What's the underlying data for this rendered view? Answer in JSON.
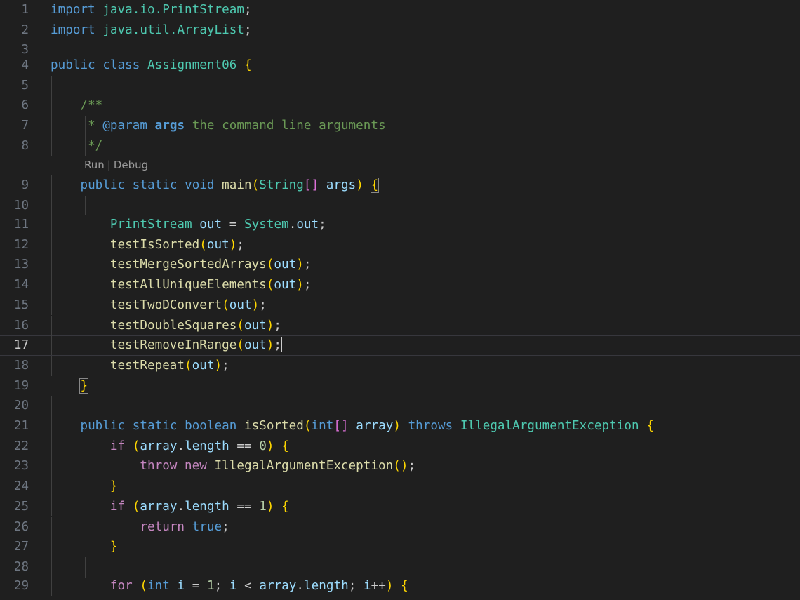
{
  "editor": {
    "language": "java",
    "theme": "Dark Modern",
    "background_color": "#1f1f1f",
    "active_line_number": 17,
    "cursor_line": 17,
    "cursor_column": 31,
    "gutter": {
      "line_numbers": [
        1,
        2,
        3,
        4,
        5,
        6,
        7,
        8,
        9,
        10,
        11,
        12,
        13,
        14,
        15,
        16,
        17,
        18,
        19,
        20,
        21,
        22,
        23,
        24,
        25,
        26,
        27,
        28,
        29
      ],
      "inactive_color": "#6e7681",
      "active_color": "#cccccc"
    },
    "codelens": {
      "run_label": "Run",
      "separator": "|",
      "debug_label": "Debug",
      "attached_to_line": 9
    },
    "syntax_colors": {
      "keyword": "#569cd6",
      "control_keyword": "#c586c0",
      "type": "#4ec9b0",
      "function": "#dcdcaa",
      "variable": "#9cdcfe",
      "number": "#b5cea8",
      "comment": "#6a9955",
      "punctuation": "#cccccc",
      "bracket_1": "#ffd700",
      "bracket_2": "#da70d6",
      "bracket_3": "#179fff"
    },
    "lines": {
      "l1": {
        "n": "1",
        "text": "import java.io.PrintStream;"
      },
      "l2": {
        "n": "2",
        "text": "import java.util.ArrayList;"
      },
      "l3": {
        "n": "3",
        "text": ""
      },
      "l4": {
        "n": "4",
        "text": "public class Assignment06 {"
      },
      "l5": {
        "n": "5",
        "text": ""
      },
      "l6": {
        "n": "6",
        "text": "    /**"
      },
      "l7": {
        "n": "7",
        "text": "     * @param args the command line arguments"
      },
      "l8": {
        "n": "8",
        "text": "     */"
      },
      "l9": {
        "n": "9",
        "text": "    public static void main(String[] args) {"
      },
      "l10": {
        "n": "10",
        "text": ""
      },
      "l11": {
        "n": "11",
        "text": "        PrintStream out = System.out;"
      },
      "l12": {
        "n": "12",
        "text": "        testIsSorted(out);"
      },
      "l13": {
        "n": "13",
        "text": "        testMergeSortedArrays(out);"
      },
      "l14": {
        "n": "14",
        "text": "        testAllUniqueElements(out);"
      },
      "l15": {
        "n": "15",
        "text": "        testTwoDConvert(out);"
      },
      "l16": {
        "n": "16",
        "text": "        testDoubleSquares(out);"
      },
      "l17": {
        "n": "17",
        "text": "        testRemoveInRange(out);"
      },
      "l18": {
        "n": "18",
        "text": "        testRepeat(out);"
      },
      "l19": {
        "n": "19",
        "text": "    }"
      },
      "l20": {
        "n": "20",
        "text": ""
      },
      "l21": {
        "n": "21",
        "text": "    public static boolean isSorted(int[] array) throws IllegalArgumentException {"
      },
      "l22": {
        "n": "22",
        "text": "        if (array.length == 0) {"
      },
      "l23": {
        "n": "23",
        "text": "            throw new IllegalArgumentException();"
      },
      "l24": {
        "n": "24",
        "text": "        }"
      },
      "l25": {
        "n": "25",
        "text": "        if (array.length == 1) {"
      },
      "l26": {
        "n": "26",
        "text": "            return true;"
      },
      "l27": {
        "n": "27",
        "text": "        }"
      },
      "l28": {
        "n": "28",
        "text": ""
      },
      "l29": {
        "n": "29",
        "text": "        for (int i = 1; i < array.length; i++) {"
      }
    },
    "tokens": {
      "import": "import",
      "public": "public",
      "class": "class",
      "static": "static",
      "void": "void",
      "boolean": "boolean",
      "int": "int",
      "if": "if",
      "for": "for",
      "return": "return",
      "throw": "throw",
      "throws": "throws",
      "new": "new",
      "true": "true",
      "javaio": "java.io.",
      "javautil": "java.util.",
      "PrintStream": "PrintStream",
      "ArrayList": "ArrayList",
      "Assignment06": "Assignment06",
      "System": "System",
      "String": "String",
      "IllegalArgumentException": "IllegalArgumentException",
      "main": "main",
      "isSorted": "isSorted",
      "args": "args",
      "out": "out",
      "array": "array",
      "length": "length",
      "i": "i",
      "doc_open": "/**",
      "doc_star": "*",
      "doc_close": "*/",
      "doc_param": "@param",
      "doc_text": "the command line arguments",
      "call_testIsSorted": "testIsSorted",
      "call_testMergeSortedArrays": "testMergeSortedArrays",
      "call_testAllUniqueElements": "testAllUniqueElements",
      "call_testTwoDConvert": "testTwoDConvert",
      "call_testDoubleSquares": "testDoubleSquares",
      "call_testRemoveInRange": "testRemoveInRange",
      "call_testRepeat": "testRepeat",
      "num_0": "0",
      "num_1": "1"
    }
  }
}
